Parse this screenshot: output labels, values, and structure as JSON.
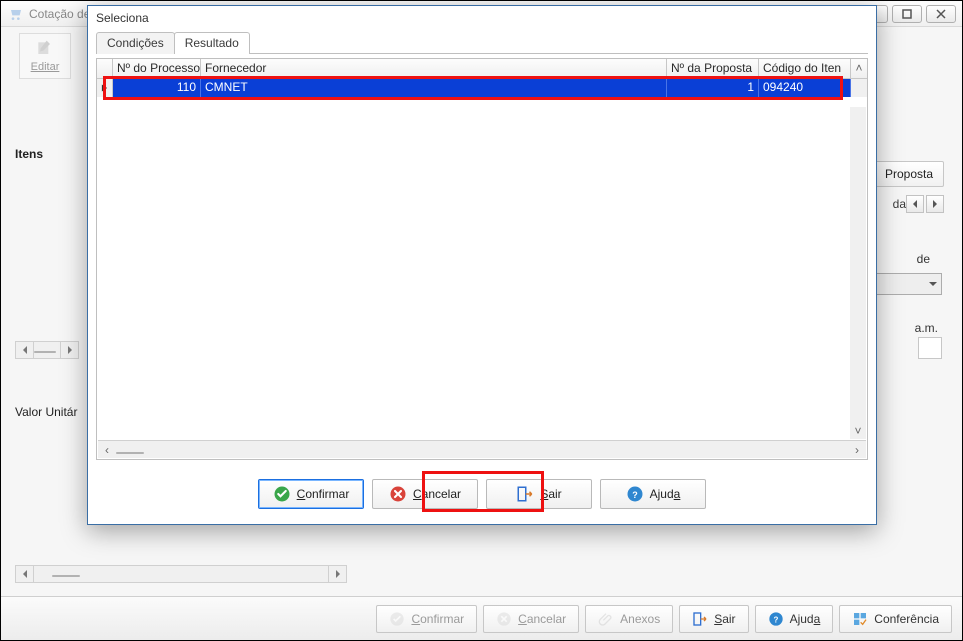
{
  "parent": {
    "title": "Cotação de Preços",
    "editar": "Editar",
    "proposta": "Proposta",
    "dac_label": "da C",
    "de_label": "de",
    "am_label": "a.m.",
    "itens": "Itens",
    "valor_unit": "Valor Unitár",
    "bottom": {
      "confirmar": "Confirmar",
      "cancelar": "Cancelar",
      "anexos": "Anexos",
      "sair": "Sair",
      "ajuda": "Ajuda",
      "conferencia": "Conferência"
    }
  },
  "modal": {
    "title": "Seleciona",
    "tabs": {
      "condicoes": "Condições",
      "resultado": "Resultado"
    },
    "columns": {
      "processo": "Nº do Processo",
      "fornecedor": "Fornecedor",
      "proposta": "Nº da Proposta",
      "codigo": "Código do Iten"
    },
    "row": {
      "processo": "110",
      "fornecedor": "CMNET",
      "proposta": "1",
      "codigo": "094240"
    },
    "buttons": {
      "confirmar": "Confirmar",
      "cancelar": "Cancelar",
      "sair": "Sair",
      "ajuda": "Ajuda"
    }
  }
}
